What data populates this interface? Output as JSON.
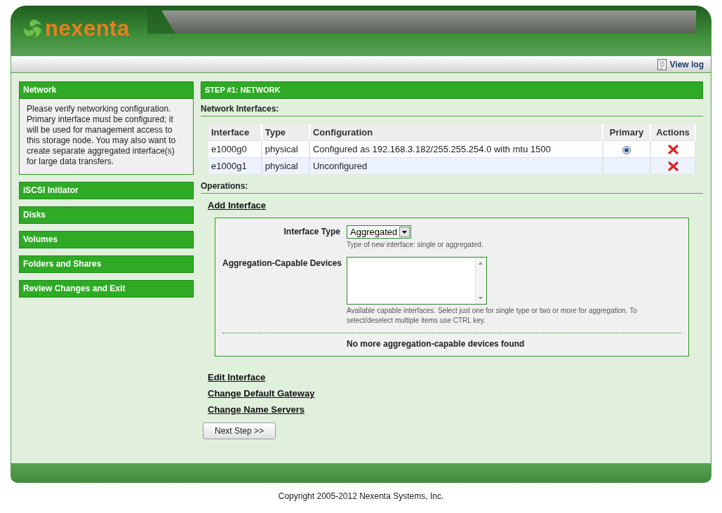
{
  "logo": {
    "text": "nexenta"
  },
  "toolbar": {
    "view_log": "View log"
  },
  "sidebar": {
    "items": [
      {
        "label": "Network",
        "expanded": true,
        "description": "Please verify networking configuration. Primary interface must be configured; it will be used for management access to this storage node. You may also want to create separate aggregated interface(s) for large data transfers."
      },
      {
        "label": "iSCSI Initiator",
        "expanded": false
      },
      {
        "label": "Disks",
        "expanded": false
      },
      {
        "label": "Volumes",
        "expanded": false
      },
      {
        "label": "Folders and Shares",
        "expanded": false
      },
      {
        "label": "Review Changes and Exit",
        "expanded": false
      }
    ]
  },
  "step_title": "STEP #1: NETWORK",
  "interfaces": {
    "heading": "Network Interfaces:",
    "columns": [
      "Interface",
      "Type",
      "Configuration",
      "Primary",
      "Actions"
    ],
    "rows": [
      {
        "interface": "e1000g0",
        "type": "physical",
        "configuration": "Configured as 192.168.3.182/255.255.254.0 with mtu 1500",
        "primary": true
      },
      {
        "interface": "e1000g1",
        "type": "physical",
        "configuration": "Unconfigured",
        "primary": false
      }
    ]
  },
  "operations": {
    "heading": "Operations:",
    "add_interface": {
      "title": "Add Interface",
      "type_label": "Interface Type",
      "type_value": "Aggregated",
      "type_hint": "Type of new interface: single or aggregated.",
      "devices_label": "Aggregation-Capable Devices",
      "devices_hint": "Available capable interfaces. Select just one for single type or two or more for aggregation. To select/deselect multiple items use CTRL key.",
      "notice": "No more aggregation-capable devices found"
    },
    "links": [
      "Edit Interface",
      "Change Default Gateway",
      "Change Name Servers"
    ]
  },
  "next_button": "Next Step >>",
  "copyright": "Copyright 2005-2012 Nexenta Systems, Inc."
}
